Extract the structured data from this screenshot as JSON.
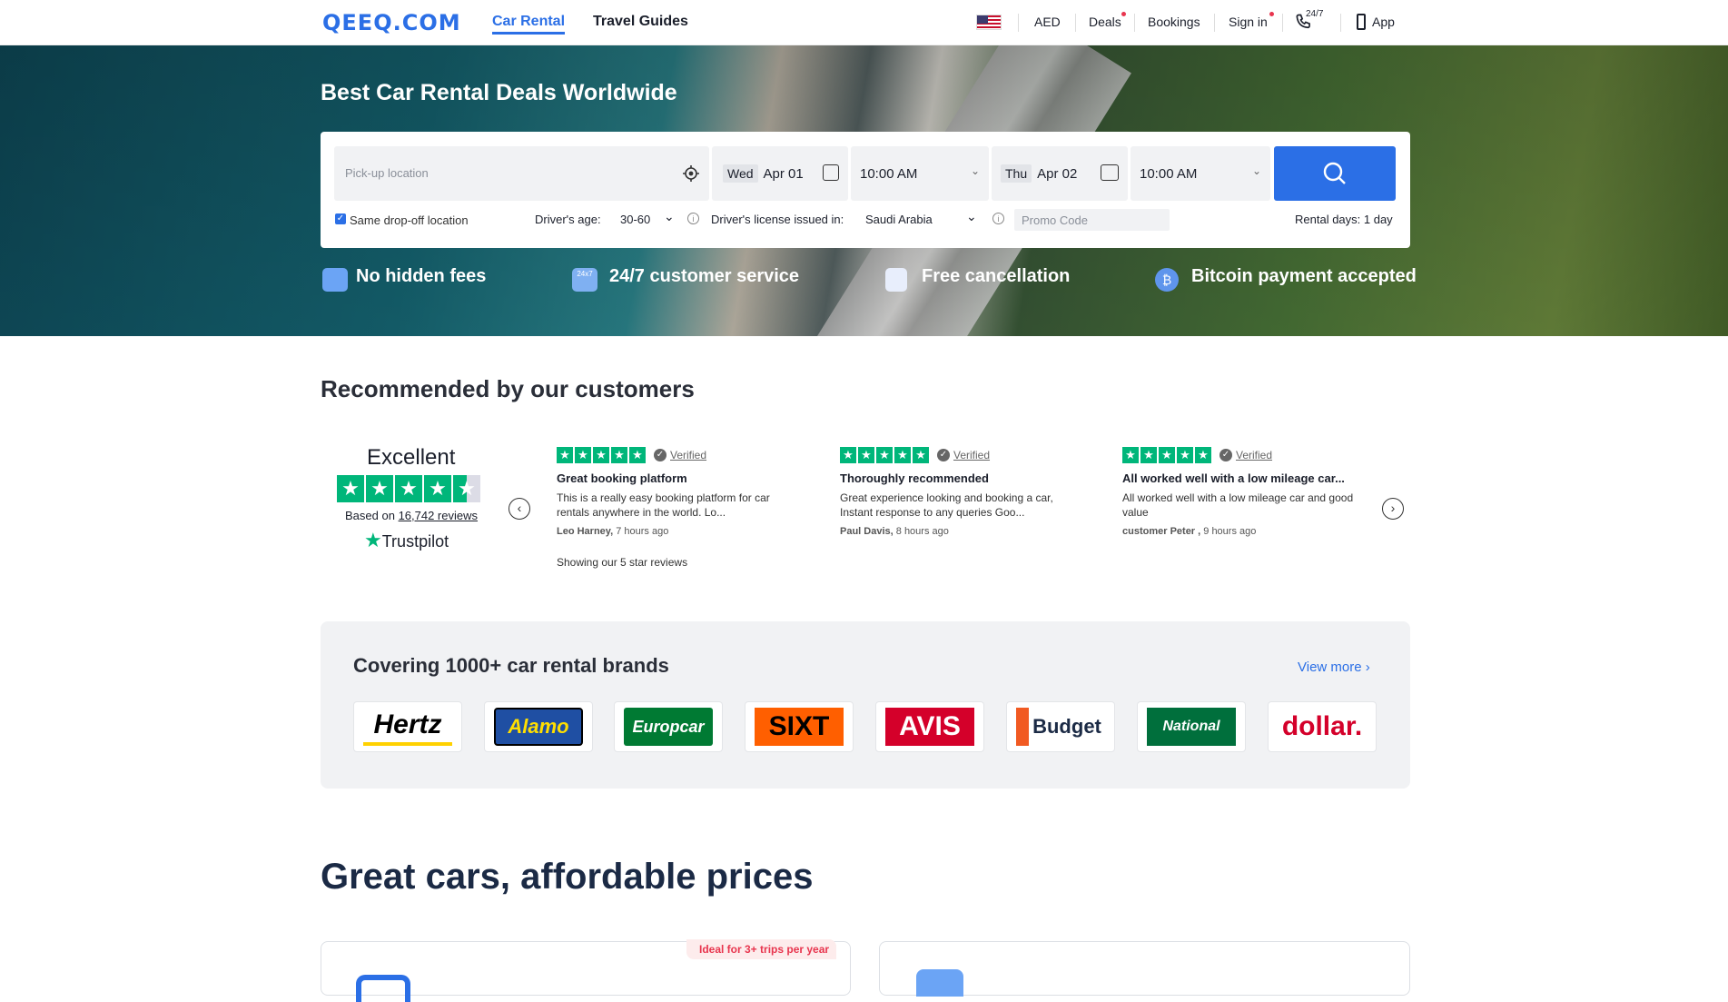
{
  "header": {
    "logo": "QEEQ.COM",
    "nav": {
      "car_rental": "Car Rental",
      "travel_guides": "Travel Guides"
    },
    "currency": "AED",
    "deals": "Deals",
    "bookings": "Bookings",
    "sign_in": "Sign in",
    "support_badge": "24/7",
    "app": "App"
  },
  "hero": {
    "title": "Best Car Rental Deals Worldwide",
    "search": {
      "pickup_placeholder": "Pick-up location",
      "pickup_day": "Wed",
      "pickup_date": "Apr 01",
      "pickup_time": "10:00 AM",
      "dropoff_day": "Thu",
      "dropoff_date": "Apr 02",
      "dropoff_time": "10:00 AM",
      "same_dropoff_label": "Same drop-off location",
      "same_dropoff_checked": true,
      "driver_age_label": "Driver's age:",
      "driver_age_value": "30-60",
      "license_label": "Driver's license issued in:",
      "license_value": "Saudi Arabia",
      "promo_placeholder": "Promo Code",
      "rental_days": "Rental days: 1 day"
    },
    "features": [
      {
        "label": "No hidden fees",
        "icon": "wallet-icon"
      },
      {
        "label": "24/7 customer service",
        "icon": "chat-icon"
      },
      {
        "label": "Free cancellation",
        "icon": "cancel-icon"
      },
      {
        "label": "Bitcoin payment accepted",
        "icon": "bitcoin-icon"
      }
    ]
  },
  "reviews": {
    "section_title": "Recommended by our customers",
    "summary": {
      "rating_word": "Excellent",
      "based_on": "Based on",
      "review_count": "16,742 reviews",
      "brand": "Trustpilot",
      "showing": "Showing our 5 star reviews"
    },
    "items": [
      {
        "verified": "Verified",
        "title": "Great booking platform",
        "body": "This is a really easy booking platform for car rentals anywhere in the world. Lo...",
        "author": "Leo Harney,",
        "time": "7 hours ago"
      },
      {
        "verified": "Verified",
        "title": "Thoroughly recommended",
        "body": "Great experience looking and booking a car, Instant response to any queries Goo...",
        "author": "Paul Davis,",
        "time": "8 hours ago"
      },
      {
        "verified": "Verified",
        "title": "All worked well with a low mileage car...",
        "body": "All worked well with a low mileage car and good value",
        "author": "customer Peter ,",
        "time": "9 hours ago"
      }
    ]
  },
  "brands": {
    "title": "Covering 1000+ car rental brands",
    "view_more": "View more",
    "items": [
      {
        "name": "Hertz",
        "color": "#000000",
        "bg": "#ffffff",
        "accent": "#ffd100"
      },
      {
        "name": "Alamo",
        "color": "#ffde00",
        "bg": "#1f4fa3",
        "accent": "#000000"
      },
      {
        "name": "Europcar",
        "color": "#ffffff",
        "bg": "#007a33",
        "accent": "#ffde00"
      },
      {
        "name": "SIXT",
        "color": "#000000",
        "bg": "#ff5f00",
        "accent": "#ffffff"
      },
      {
        "name": "AVIS",
        "color": "#ffffff",
        "bg": "#d4002a",
        "accent": "#ffffff"
      },
      {
        "name": "Budget",
        "color": "#1b2a45",
        "bg": "#ffffff",
        "accent": "#f15a22"
      },
      {
        "name": "National",
        "color": "#ffffff",
        "bg": "#006f3c",
        "accent": "#ffffff"
      },
      {
        "name": "dollar.",
        "color": "#d4002a",
        "bg": "#ffffff",
        "accent": "#d4002a"
      }
    ]
  },
  "great_cars": {
    "title": "Great cars, affordable prices",
    "badge": "Ideal for 3+ trips per year"
  },
  "colors": {
    "primary": "#2b6fe6",
    "trustpilot": "#00b67a",
    "alert": "#e8354e"
  }
}
